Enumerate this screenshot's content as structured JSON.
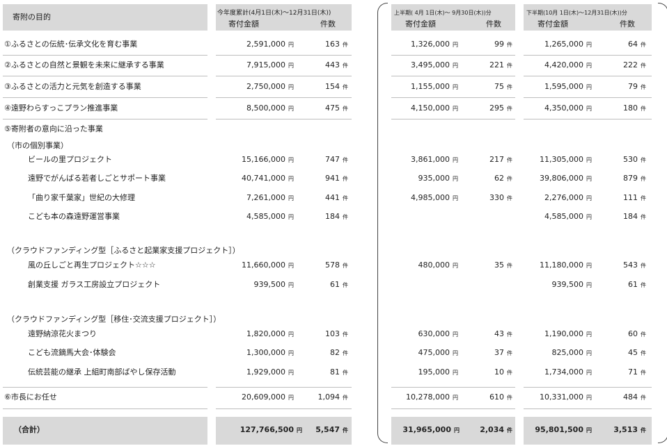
{
  "headers": {
    "purpose": "寄附の目的",
    "ytd_title": "今年度累計(4月1日(木)～12月31日(木))",
    "h1_title": "上半期( 4月 1日(木)～ 9月30日(木))分",
    "h2_title": "下半期(10月 1日(木)～12月31日(木))分",
    "amount": "寄付金額",
    "count": "件数"
  },
  "units": {
    "yen": "円",
    "ken": "件"
  },
  "rows": [
    {
      "label": "①ふるさとの伝統･伝承文化を育む事業",
      "indent": 0,
      "ytd_amount": "2,591,000",
      "ytd_count": "163",
      "h1_amount": "1,326,000",
      "h1_count": "99",
      "h2_amount": "1,265,000",
      "h2_count": "64"
    },
    {
      "label": "②ふるさとの自然と景観を未来に継承する事業",
      "indent": 0,
      "ytd_amount": "7,915,000",
      "ytd_count": "443",
      "h1_amount": "3,495,000",
      "h1_count": "221",
      "h2_amount": "4,420,000",
      "h2_count": "222"
    },
    {
      "label": "③ふるさとの活力と元気を創造する事業",
      "indent": 0,
      "ytd_amount": "2,750,000",
      "ytd_count": "154",
      "h1_amount": "1,155,000",
      "h1_count": "75",
      "h2_amount": "1,595,000",
      "h2_count": "79"
    },
    {
      "label": "④遠野わらすっこプラン推進事業",
      "indent": 0,
      "ytd_amount": "8,500,000",
      "ytd_count": "475",
      "h1_amount": "4,150,000",
      "h1_count": "295",
      "h2_amount": "4,350,000",
      "h2_count": "180"
    },
    {
      "label": "⑤寄附者の意向に沿った事業",
      "indent": 0
    },
    {
      "label": "（市の個別事業）",
      "indent": 1
    },
    {
      "label": "ビールの里プロジェクト",
      "indent": 2,
      "ytd_amount": "15,166,000",
      "ytd_count": "747",
      "h1_amount": "3,861,000",
      "h1_count": "217",
      "h2_amount": "11,305,000",
      "h2_count": "530"
    },
    {
      "label": "遠野でがんばる若者しごとサポート事業",
      "indent": 2,
      "ytd_amount": "40,741,000",
      "ytd_count": "941",
      "h1_amount": "935,000",
      "h1_count": "62",
      "h2_amount": "39,806,000",
      "h2_count": "879"
    },
    {
      "label": "「曲り家千葉家」世紀の大修理",
      "indent": 2,
      "ytd_amount": "7,261,000",
      "ytd_count": "441",
      "h1_amount": "4,985,000",
      "h1_count": "330",
      "h2_amount": "2,276,000",
      "h2_count": "111"
    },
    {
      "label": "こども本の森遠野運営事業",
      "indent": 2,
      "ytd_amount": "4,585,000",
      "ytd_count": "184",
      "h2_amount": "4,585,000",
      "h2_count": "184"
    },
    {
      "label": "（クラウドファンディング型［ふるさと起業家支援プロジェクト］）",
      "indent": 1
    },
    {
      "label": "風の丘しごと再生プロジェクト☆☆☆",
      "indent": 2,
      "ytd_amount": "11,660,000",
      "ytd_count": "578",
      "h1_amount": "480,000",
      "h1_count": "35",
      "h2_amount": "11,180,000",
      "h2_count": "543"
    },
    {
      "label": "創業支援 ガラス工房設立プロジェクト",
      "indent": 2,
      "ytd_amount": "939,500",
      "ytd_count": "61",
      "h2_amount": "939,500",
      "h2_count": "61"
    },
    {
      "label": "（クラウドファンディング型［移住･交流支援プロジェクト］）",
      "indent": 1
    },
    {
      "label": "遠野納涼花火まつり",
      "indent": 2,
      "ytd_amount": "1,820,000",
      "ytd_count": "103",
      "h1_amount": "630,000",
      "h1_count": "43",
      "h2_amount": "1,190,000",
      "h2_count": "60"
    },
    {
      "label": "こども流鏑馬大会･体験会",
      "indent": 2,
      "ytd_amount": "1,300,000",
      "ytd_count": "82",
      "h1_amount": "475,000",
      "h1_count": "37",
      "h2_amount": "825,000",
      "h2_count": "45"
    },
    {
      "label": "伝統芸能の継承 上組町南部ばやし保存活動",
      "indent": 2,
      "ytd_amount": "1,929,000",
      "ytd_count": "81",
      "h1_amount": "195,000",
      "h1_count": "10",
      "h2_amount": "1,734,000",
      "h2_count": "71"
    },
    {
      "label": "⑥市長にお任せ",
      "indent": 0,
      "ytd_amount": "20,609,000",
      "ytd_count": "1,094",
      "h1_amount": "10,278,000",
      "h1_count": "610",
      "h2_amount": "10,331,000",
      "h2_count": "484"
    }
  ],
  "total": {
    "label": "（合計）",
    "ytd_amount": "127,766,500",
    "ytd_count": "5,547",
    "h1_amount": "31,965,000",
    "h1_count": "2,034",
    "h2_amount": "95,801,500",
    "h2_count": "3,513"
  }
}
